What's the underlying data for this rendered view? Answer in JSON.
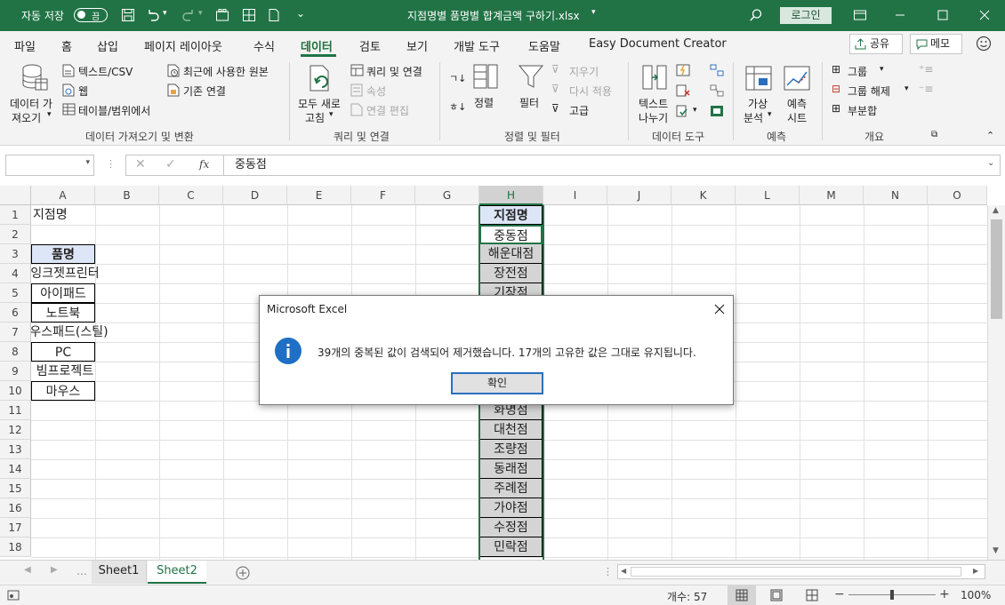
{
  "titlebar": {
    "autosave_label": "자동 저장",
    "autosave_state": "끔",
    "document_title": "지점명별 품명별 합계금액 구하기.xlsx",
    "login": "로그인"
  },
  "menu": {
    "tabs": [
      "파일",
      "홈",
      "삽입",
      "페이지 레이아웃",
      "수식",
      "데이터",
      "검토",
      "보기",
      "개발 도구",
      "도움말",
      "Easy Document Creator"
    ],
    "active": "데이터",
    "share": "공유",
    "memo": "메모"
  },
  "ribbon": {
    "get_data_l1": "데이터 가",
    "get_data_l2": "져오기",
    "text_csv": "텍스트/CSV",
    "web": "웹",
    "from_table": "테이블/범위에서",
    "recent_sources": "최근에 사용한 원본",
    "existing_conn": "기존 연결",
    "group1": "데이터 가져오기 및 변환",
    "refresh_all_l1": "모두 새로",
    "refresh_all_l2": "고침",
    "queries_conn": "쿼리 및 연결",
    "properties": "속성",
    "edit_links": "연결 편집",
    "group2": "쿼리 및 연결",
    "sort": "정렬",
    "filter": "필터",
    "clear": "지우기",
    "reapply": "다시 적용",
    "advanced": "고급",
    "group3": "정렬 및 필터",
    "text_to_col_l1": "텍스트",
    "text_to_col_l2": "나누기",
    "group4": "데이터 도구",
    "whatif_l1": "가상",
    "whatif_l2": "분석",
    "forecast_l1": "예측",
    "forecast_l2": "시트",
    "group5": "예측",
    "group_btn": "그룹",
    "ungroup_btn": "그룹 해제",
    "subtotal": "부분합",
    "group6": "개요"
  },
  "formula_bar": {
    "name_box": "",
    "value": "중동점"
  },
  "columns": [
    "A",
    "B",
    "C",
    "D",
    "E",
    "F",
    "G",
    "H",
    "I",
    "J",
    "K",
    "L",
    "M",
    "N",
    "O"
  ],
  "rows": [
    "1",
    "2",
    "3",
    "4",
    "5",
    "6",
    "7",
    "8",
    "9",
    "10",
    "11",
    "12",
    "13",
    "14",
    "15",
    "16",
    "17",
    "18"
  ],
  "col_a": {
    "r1": "지점명",
    "r3": "품명",
    "r4": "잉크젯프린터",
    "r5": "아이패드",
    "r6": "노트북",
    "r7": "마우스패드(스틸)",
    "r8": "PC",
    "r9": "빔프로젝트",
    "r10": "마우스"
  },
  "col_h": [
    "지점명",
    "중동점",
    "해운대점",
    "장전점",
    "기장점",
    "",
    "",
    "",
    "",
    "",
    "화명점",
    "대천점",
    "조량점",
    "동래점",
    "주례점",
    "가야점",
    "수정점",
    "민락점"
  ],
  "sheets": [
    "Sheet1",
    "Sheet2"
  ],
  "active_sheet": "Sheet2",
  "status": {
    "count": "개수: 57",
    "zoom": "100%"
  },
  "dialog": {
    "title": "Microsoft Excel",
    "message": "39개의 중복된 값이 검색되어 제거했습니다. 17개의 고유한 값은 그대로 유지됩니다.",
    "ok": "확인"
  },
  "colors": {
    "accent": "#217346",
    "header_fill": "#dde6f6",
    "selection_fill": "#d4d4d4",
    "info_icon": "#1f6fc5"
  }
}
